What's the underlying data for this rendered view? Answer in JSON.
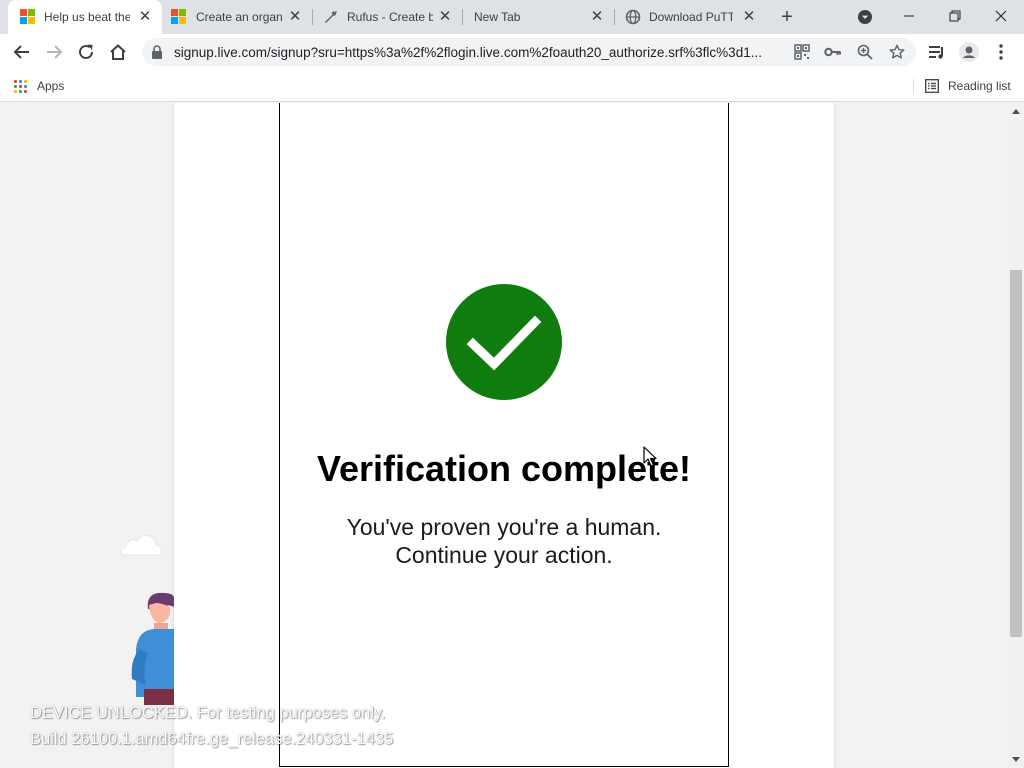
{
  "colors": {
    "success_green": "#107c10",
    "tabstrip_bg": "#dee1e6",
    "omnibox_bg": "#f1f3f4",
    "ms_red": "#f25022",
    "ms_green": "#7fba00",
    "ms_blue": "#00a4ef",
    "ms_yellow": "#ffb900"
  },
  "tabs": [
    {
      "title": "Help us beat the robots",
      "icon": "microsoft-logo-icon",
      "active": true
    },
    {
      "title": "Create an organization",
      "icon": "microsoft-logo-icon",
      "active": false
    },
    {
      "title": "Rufus - Create bootable USB drives",
      "icon": "rufus-icon",
      "active": false
    },
    {
      "title": "New Tab",
      "icon": "",
      "active": false
    },
    {
      "title": "Download PuTTY",
      "icon": "globe-icon",
      "active": false
    }
  ],
  "toolbar": {
    "url": "signup.live.com/signup?sru=https%3a%2f%2flogin.live.com%2foauth20_authorize.srf%3flc%3d1..."
  },
  "bookmarks": {
    "apps_label": "Apps",
    "reading_list_label": "Reading list"
  },
  "verification": {
    "title": "Verification complete!",
    "line1": "You've proven you're a human.",
    "line2": "Continue your action."
  },
  "watermark": {
    "line1": "DEVICE UNLOCKED. For testing purposes only.",
    "line2": "Build 26100.1.amd64fre.ge_release.240331-1435"
  }
}
